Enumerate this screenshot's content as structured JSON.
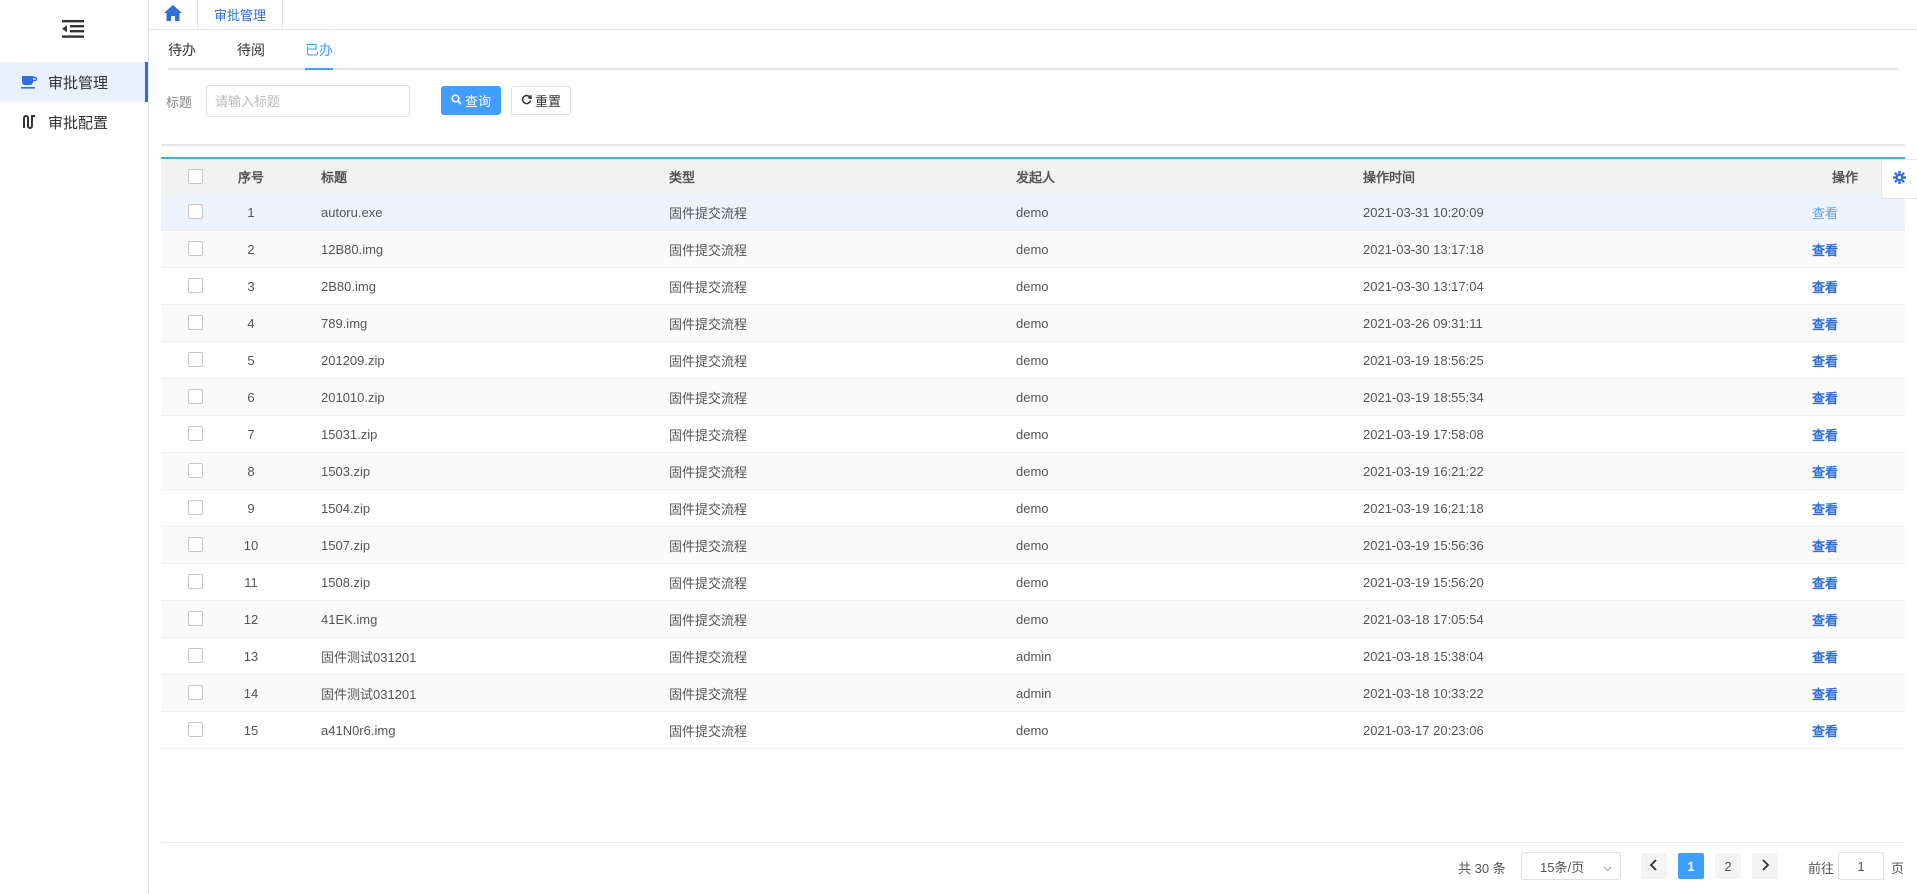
{
  "sidebar": {
    "toggle_icon": "menu-fold-icon",
    "items": [
      {
        "label": "审批管理",
        "icon": "cup-icon",
        "active": true
      },
      {
        "label": "审批配置",
        "icon": "config-icon",
        "active": false
      }
    ]
  },
  "topbar": {
    "home_icon": "home-icon",
    "tab_label": "审批管理"
  },
  "subtabs": [
    {
      "label": "待办",
      "active": false
    },
    {
      "label": "待阅",
      "active": false
    },
    {
      "label": "已办",
      "active": true
    }
  ],
  "search": {
    "label": "标题",
    "placeholder": "请输入标题",
    "value": "",
    "query_label": "查询",
    "reset_label": "重置"
  },
  "table": {
    "columns": {
      "no": "序号",
      "title": "标题",
      "type": "类型",
      "user": "发起人",
      "time": "操作时间",
      "op": "操作"
    },
    "rows": [
      {
        "no": "1",
        "title": "autoru.exe",
        "type": "固件提交流程",
        "user": "demo",
        "time": "2021-03-31 10:20:09",
        "op": "查看"
      },
      {
        "no": "2",
        "title": "12B80.img",
        "type": "固件提交流程",
        "user": "demo",
        "time": "2021-03-30 13:17:18",
        "op": "查看"
      },
      {
        "no": "3",
        "title": "2B80.img",
        "type": "固件提交流程",
        "user": "demo",
        "time": "2021-03-30 13:17:04",
        "op": "查看"
      },
      {
        "no": "4",
        "title": "789.img",
        "type": "固件提交流程",
        "user": "demo",
        "time": "2021-03-26 09:31:11",
        "op": "查看"
      },
      {
        "no": "5",
        "title": "201209.zip",
        "type": "固件提交流程",
        "user": "demo",
        "time": "2021-03-19 18:56:25",
        "op": "查看"
      },
      {
        "no": "6",
        "title": "201010.zip",
        "type": "固件提交流程",
        "user": "demo",
        "time": "2021-03-19 18:55:34",
        "op": "查看"
      },
      {
        "no": "7",
        "title": "15031.zip",
        "type": "固件提交流程",
        "user": "demo",
        "time": "2021-03-19 17:58:08",
        "op": "查看"
      },
      {
        "no": "8",
        "title": "1503.zip",
        "type": "固件提交流程",
        "user": "demo",
        "time": "2021-03-19 16:21:22",
        "op": "查看"
      },
      {
        "no": "9",
        "title": "1504.zip",
        "type": "固件提交流程",
        "user": "demo",
        "time": "2021-03-19 16:21:18",
        "op": "查看"
      },
      {
        "no": "10",
        "title": "1507.zip",
        "type": "固件提交流程",
        "user": "demo",
        "time": "2021-03-19 15:56:36",
        "op": "查看"
      },
      {
        "no": "11",
        "title": "1508.zip",
        "type": "固件提交流程",
        "user": "demo",
        "time": "2021-03-19 15:56:20",
        "op": "查看"
      },
      {
        "no": "12",
        "title": "41EK.img",
        "type": "固件提交流程",
        "user": "demo",
        "time": "2021-03-18 17:05:54",
        "op": "查看"
      },
      {
        "no": "13",
        "title": "固件测试031201",
        "type": "固件提交流程",
        "user": "admin",
        "time": "2021-03-18 15:38:04",
        "op": "查看"
      },
      {
        "no": "14",
        "title": "固件测试031201",
        "type": "固件提交流程",
        "user": "admin",
        "time": "2021-03-18 10:33:22",
        "op": "查看"
      },
      {
        "no": "15",
        "title": "a41N0r6.img",
        "type": "固件提交流程",
        "user": "demo",
        "time": "2021-03-17 20:23:06",
        "op": "查看"
      }
    ]
  },
  "pagination": {
    "total": "共 30 条",
    "page_size": "15条/页",
    "pages": [
      "1",
      "2"
    ],
    "current_page": "1",
    "goto_prefix": "前往",
    "goto_value": "1",
    "goto_suffix": "页"
  },
  "colors": {
    "accent": "#409eff",
    "link": "#2f6fd6",
    "table_top_border": "#3cb4dc"
  }
}
